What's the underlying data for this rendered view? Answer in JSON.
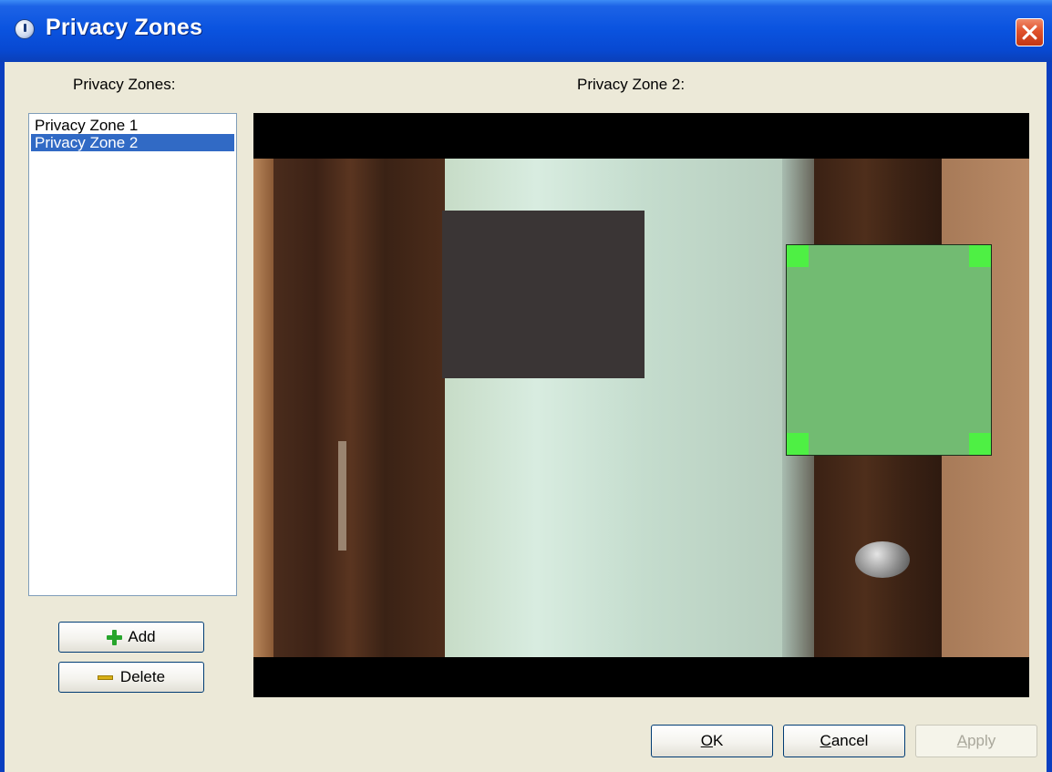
{
  "window": {
    "title": "Privacy Zones"
  },
  "left_panel": {
    "header": "Privacy Zones:",
    "zones": [
      {
        "label": "Privacy Zone 1",
        "selected": false
      },
      {
        "label": "Privacy Zone 2",
        "selected": true
      }
    ],
    "add_label": "Add",
    "delete_label": "Delete"
  },
  "preview": {
    "header": "Privacy Zone 2:"
  },
  "footer": {
    "ok_label": "OK",
    "ok_mnemonic": "O",
    "ok_rest": "K",
    "cancel_label": "Cancel",
    "cancel_mnemonic": "C",
    "cancel_rest": "ancel",
    "apply_label": "Apply",
    "apply_mnemonic": "A",
    "apply_rest": "pply",
    "apply_enabled": false
  },
  "icons": {
    "window_icon": "info-icon",
    "close": "close-icon",
    "add": "plus-icon",
    "delete": "minus-icon"
  },
  "colors": {
    "title_bar": "#0b54e0",
    "selection": "#316ac5",
    "zone_fill_selected": "#72bb72",
    "zone_handle": "#4ef044",
    "zone_fill_inactive": "#3a3535"
  }
}
